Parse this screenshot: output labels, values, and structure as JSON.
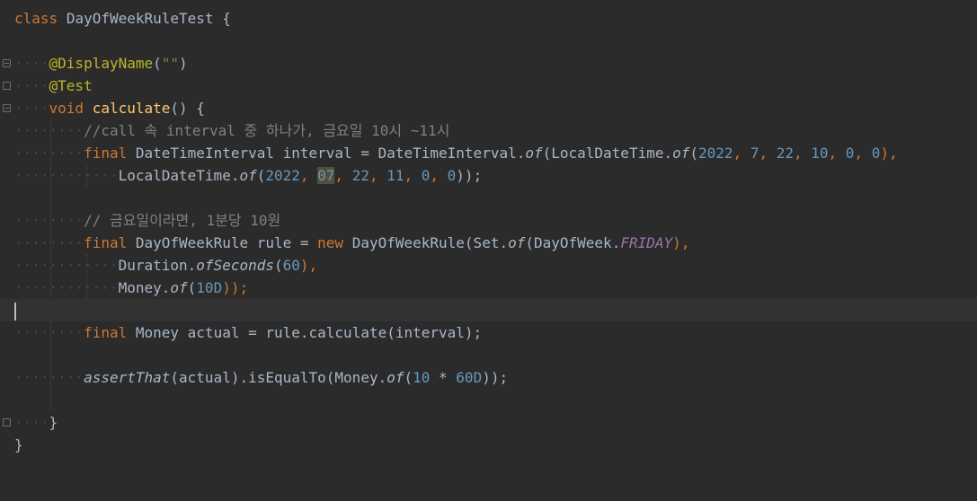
{
  "editor": {
    "lines": {
      "l1": {
        "kw": "class",
        "name": "DayOfWeekRuleTest",
        "brace": "{"
      },
      "l3": {
        "ann": "@DisplayName",
        "open": "(",
        "str": "\"\"",
        "close": ")"
      },
      "l4": {
        "ann": "@Test"
      },
      "l5": {
        "kw": "void",
        "fn": "calculate",
        "rest": "() {"
      },
      "l6": {
        "cmt": "//call 속 interval 중 하나가, 금요일 10시 ~11시"
      },
      "l7": {
        "kw": "final",
        "t1": " DateTimeInterval interval = DateTimeInterval.",
        "of1": "of",
        "t2": "(LocalDateTime.",
        "of2": "of",
        "t3": "(",
        "n1": "2022",
        "c1": ", ",
        "n2": "7",
        "c2": ", ",
        "n3": "22",
        "c3": ", ",
        "n4": "10",
        "c4": ", ",
        "n5": "0",
        "c5": ", ",
        "n6": "0",
        "t4": "),"
      },
      "l8": {
        "t1": "LocalDateTime.",
        "of1": "of",
        "t2": "(",
        "n1": "2022",
        "c1": ", ",
        "n2": "07",
        "c2": ", ",
        "n3": "22",
        "c3": ", ",
        "n4": "11",
        "c4": ", ",
        "n5": "0",
        "c5": ", ",
        "n6": "0",
        "t3": "));"
      },
      "l10": {
        "cmt": "// 금요일이라면, 1분당 10원"
      },
      "l11": {
        "kw": "final",
        "t1": " DayOfWeekRule rule = ",
        "kw2": "new",
        "t2": " DayOfWeekRule(Set.",
        "of1": "of",
        "t3": "(DayOfWeek.",
        "const": "FRIDAY",
        "t4": "),"
      },
      "l12": {
        "t1": "Duration.",
        "m": "ofSeconds",
        "t2": "(",
        "n1": "60",
        "t3": "),"
      },
      "l13": {
        "t1": "Money.",
        "of1": "of",
        "t2": "(",
        "n1": "10D",
        "t3": "));"
      },
      "l15": {
        "kw": "final",
        "t1": " Money actual = rule.calculate(interval);"
      },
      "l17": {
        "m": "assertThat",
        "t1": "(actual).isEqualTo(Money.",
        "of1": "of",
        "t2": "(",
        "n1": "10",
        "t3": " * ",
        "n2": "60D",
        "t4": "));"
      },
      "l19": {
        "brace": "}"
      },
      "l20": {
        "brace": "}"
      }
    }
  }
}
